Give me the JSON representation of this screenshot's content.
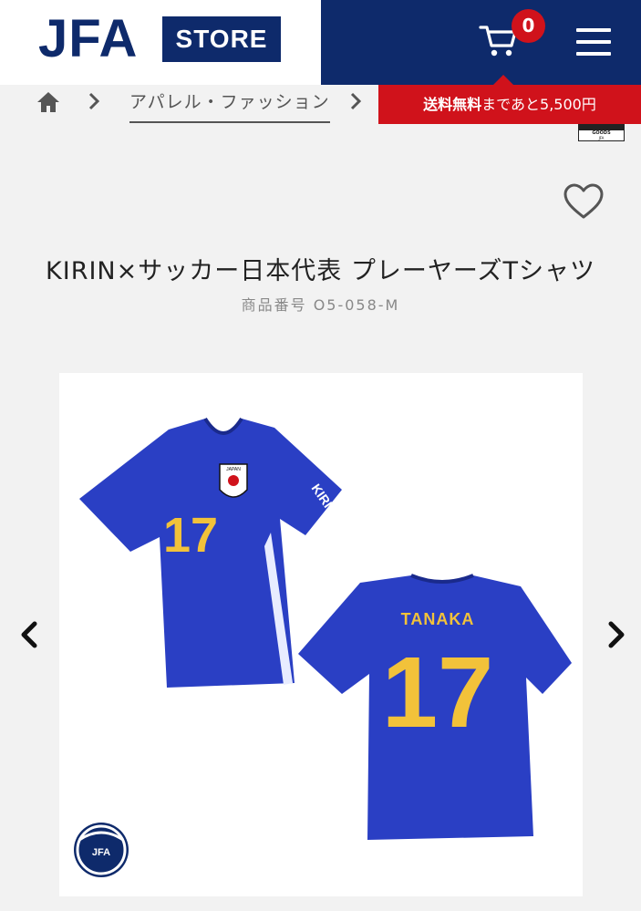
{
  "header": {
    "logo_main": "JFA",
    "logo_store": "STORE",
    "cart_count": "0"
  },
  "breadcrumb": {
    "category": "アパレル・ファッション"
  },
  "promo": {
    "strong": "送料無料",
    "rest": "まであと5,500円"
  },
  "badge": {
    "line1": "GOODS",
    "line2": "JFA"
  },
  "product": {
    "title": "KIRIN×サッカー日本代表 プレーヤーズTシャツ",
    "number": "商品番号 O5-058-M"
  },
  "gallery": {
    "front_number": "17",
    "back_name": "TANAKA",
    "back_number": "17",
    "crest_text": "JAPAN",
    "sponsor": "KIRIN",
    "jfa_mark": "JFA"
  },
  "colors": {
    "navy": "#0e2a6b",
    "red": "#d0121b",
    "jersey_blue": "#2a3fc4",
    "number_yellow": "#f2c23a"
  }
}
